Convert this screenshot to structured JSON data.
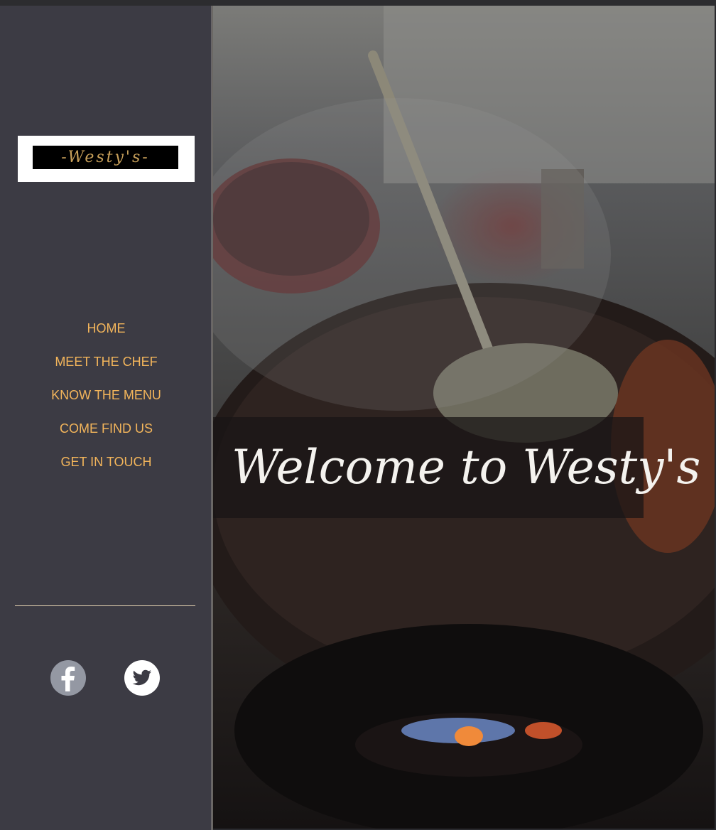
{
  "brand": {
    "logo_text": "-Westy's-"
  },
  "nav": {
    "items": [
      {
        "label": "HOME"
      },
      {
        "label": "MEET THE CHEF"
      },
      {
        "label": "KNOW THE MENU"
      },
      {
        "label": "COME FIND US"
      },
      {
        "label": "GET IN TOUCH"
      }
    ]
  },
  "social": {
    "icons": [
      "facebook-icon",
      "twitter-icon"
    ]
  },
  "hero": {
    "headline": "Welcome to Westy's"
  },
  "colors": {
    "sidebar_bg": "#3c3b44",
    "nav_text": "#f3b55b",
    "logo_gold": "#c8a05a"
  }
}
